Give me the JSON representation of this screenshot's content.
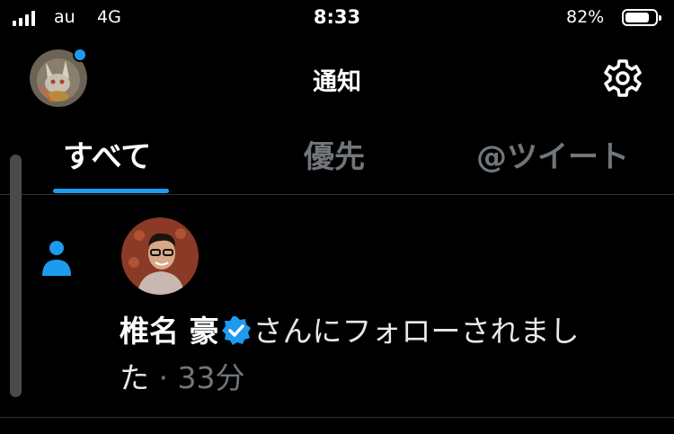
{
  "status_bar": {
    "carrier": "au",
    "network": "4G",
    "time": "8:33",
    "battery_percent": "82%",
    "battery_level": 0.82,
    "signal_bars": 4
  },
  "header": {
    "title": "通知",
    "has_unread_dot": true
  },
  "tabs": [
    {
      "label": "すべて",
      "active": true
    },
    {
      "label": "優先",
      "active": false
    },
    {
      "label": "@ツイート",
      "active": false
    }
  ],
  "notification": {
    "icon": "person-icon",
    "user_name": "椎名 豪",
    "verified": true,
    "message_line1": "さんにフォローされまし",
    "message_line2": "た",
    "separator": "·",
    "time_ago": "33分"
  },
  "colors": {
    "accent": "#1d9bf0",
    "background": "#000000",
    "muted_text": "#71767b"
  }
}
